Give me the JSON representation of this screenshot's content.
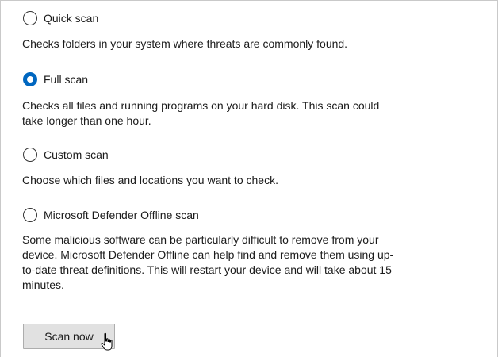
{
  "scan_options": [
    {
      "label": "Quick scan",
      "description": "Checks folders in your system where threats are commonly found.",
      "selected": false
    },
    {
      "label": "Full scan",
      "description": "Checks all files and running programs on your hard disk. This scan could take longer than one hour.",
      "selected": true
    },
    {
      "label": "Custom scan",
      "description": "Choose which files and locations you want to check.",
      "selected": false
    },
    {
      "label": "Microsoft Defender Offline scan",
      "description": "Some malicious software can be particularly difficult to remove from your device. Microsoft Defender Offline can help find and remove them using up-to-date threat definitions. This will restart your device and will take about 15 minutes.",
      "selected": false
    }
  ],
  "actions": {
    "scan_now_label": "Scan now"
  },
  "colors": {
    "accent": "#0067c0",
    "button_face": "#e1e1e1",
    "text": "#1b1b1b"
  },
  "icons": {
    "pointer": "mouse-pointer-icon"
  }
}
